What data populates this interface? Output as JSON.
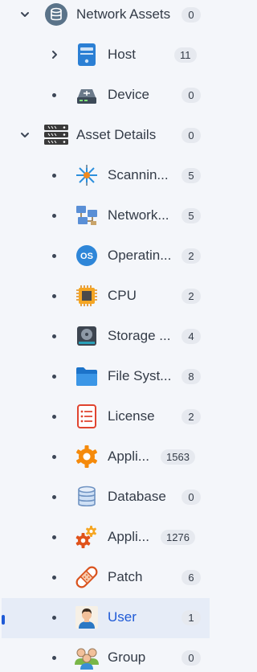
{
  "tree": {
    "groups": [
      {
        "label": "Network Assets",
        "count": "0",
        "icon": "database-circle-icon",
        "children": [
          {
            "label": "Host",
            "count": "11",
            "icon": "server-icon",
            "expandable": true
          },
          {
            "label": "Device",
            "count": "0",
            "icon": "router-icon"
          }
        ]
      },
      {
        "label": "Asset Details",
        "count": "0",
        "icon": "server-rack-icon",
        "children": [
          {
            "label": "Scannin...",
            "count": "5",
            "icon": "scan-star-icon"
          },
          {
            "label": "Network...",
            "count": "5",
            "icon": "network-computers-icon"
          },
          {
            "label": "Operatin...",
            "count": "2",
            "icon": "os-icon",
            "icon_text": "OS"
          },
          {
            "label": "CPU",
            "count": "2",
            "icon": "cpu-chip-icon"
          },
          {
            "label": "Storage ...",
            "count": "4",
            "icon": "hard-drive-icon"
          },
          {
            "label": "File Syst...",
            "count": "8",
            "icon": "folder-icon"
          },
          {
            "label": "License",
            "count": "2",
            "icon": "license-document-icon"
          },
          {
            "label": "Appli...",
            "count": "1563",
            "icon": "app-gear-icon"
          },
          {
            "label": "Database",
            "count": "0",
            "icon": "database-icon"
          },
          {
            "label": "Appli...",
            "count": "1276",
            "icon": "app-gears-icon"
          },
          {
            "label": "Patch",
            "count": "6",
            "icon": "bandage-patch-icon"
          },
          {
            "label": "User",
            "count": "1",
            "icon": "user-avatar-icon",
            "selected": true
          },
          {
            "label": "Group",
            "count": "0",
            "icon": "user-group-icon"
          }
        ]
      }
    ]
  },
  "colors": {
    "accent": "#1f5ad6",
    "text": "#333b47",
    "badge_bg": "#e6e9ef",
    "selected_bg": "#e6ecf7"
  }
}
